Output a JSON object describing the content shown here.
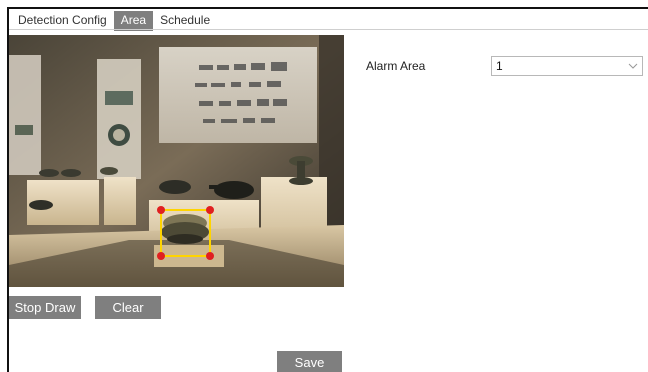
{
  "tabs": [
    {
      "label": "Detection Config",
      "active": false
    },
    {
      "label": "Area",
      "active": true
    },
    {
      "label": "Schedule",
      "active": false
    }
  ],
  "buttons": {
    "stop_draw": "Stop Draw",
    "clear": "Clear",
    "save": "Save"
  },
  "alarm_area": {
    "label": "Alarm Area",
    "value": "1",
    "icon": "chevron-down-icon"
  },
  "colors": {
    "tab_active": "#7f7f7f",
    "button": "#7f7f7f",
    "region_outline": "#ffd400",
    "region_handle": "#e02020"
  }
}
